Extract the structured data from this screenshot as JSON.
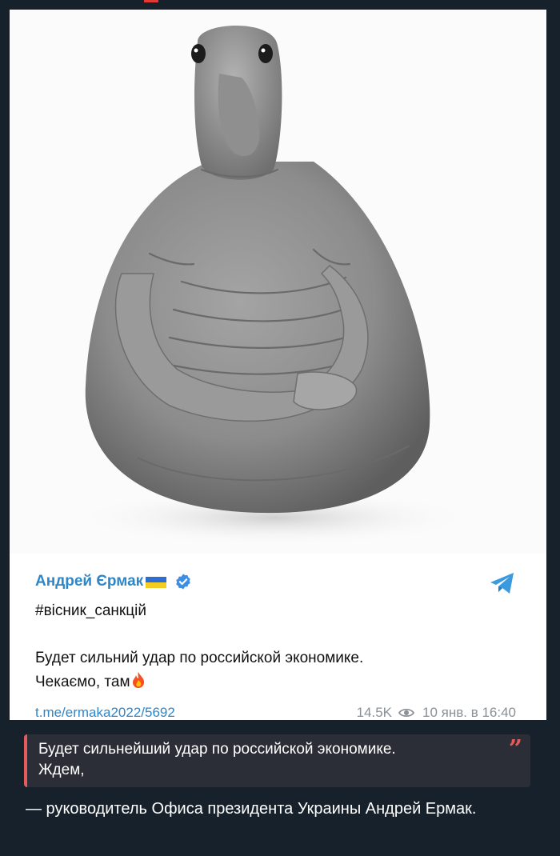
{
  "post": {
    "author": "Андрей Єрмак",
    "hashtag": "#вісник_санкцій",
    "text_line1": "Будет сильний удар по российской экономике.",
    "text_line2": "Чекаємо, там",
    "link": "t.me/ermaka2022/5692",
    "views": "14.5K",
    "date": "10 янв. в 16:40",
    "icons": [
      "flag-ukraine",
      "verified-icon",
      "telegram-icon",
      "fire-emoji",
      "eye-icon"
    ],
    "accent_color": "#2f86c7"
  },
  "quote": {
    "line1": "Будет сильнейший удар по российской экономике.",
    "line2": "Ждем,",
    "mark": "”",
    "bar_color": "#e35b5b"
  },
  "attribution": {
    "text": "— руководитель Офиса президента Украины Андрей Ермак."
  }
}
